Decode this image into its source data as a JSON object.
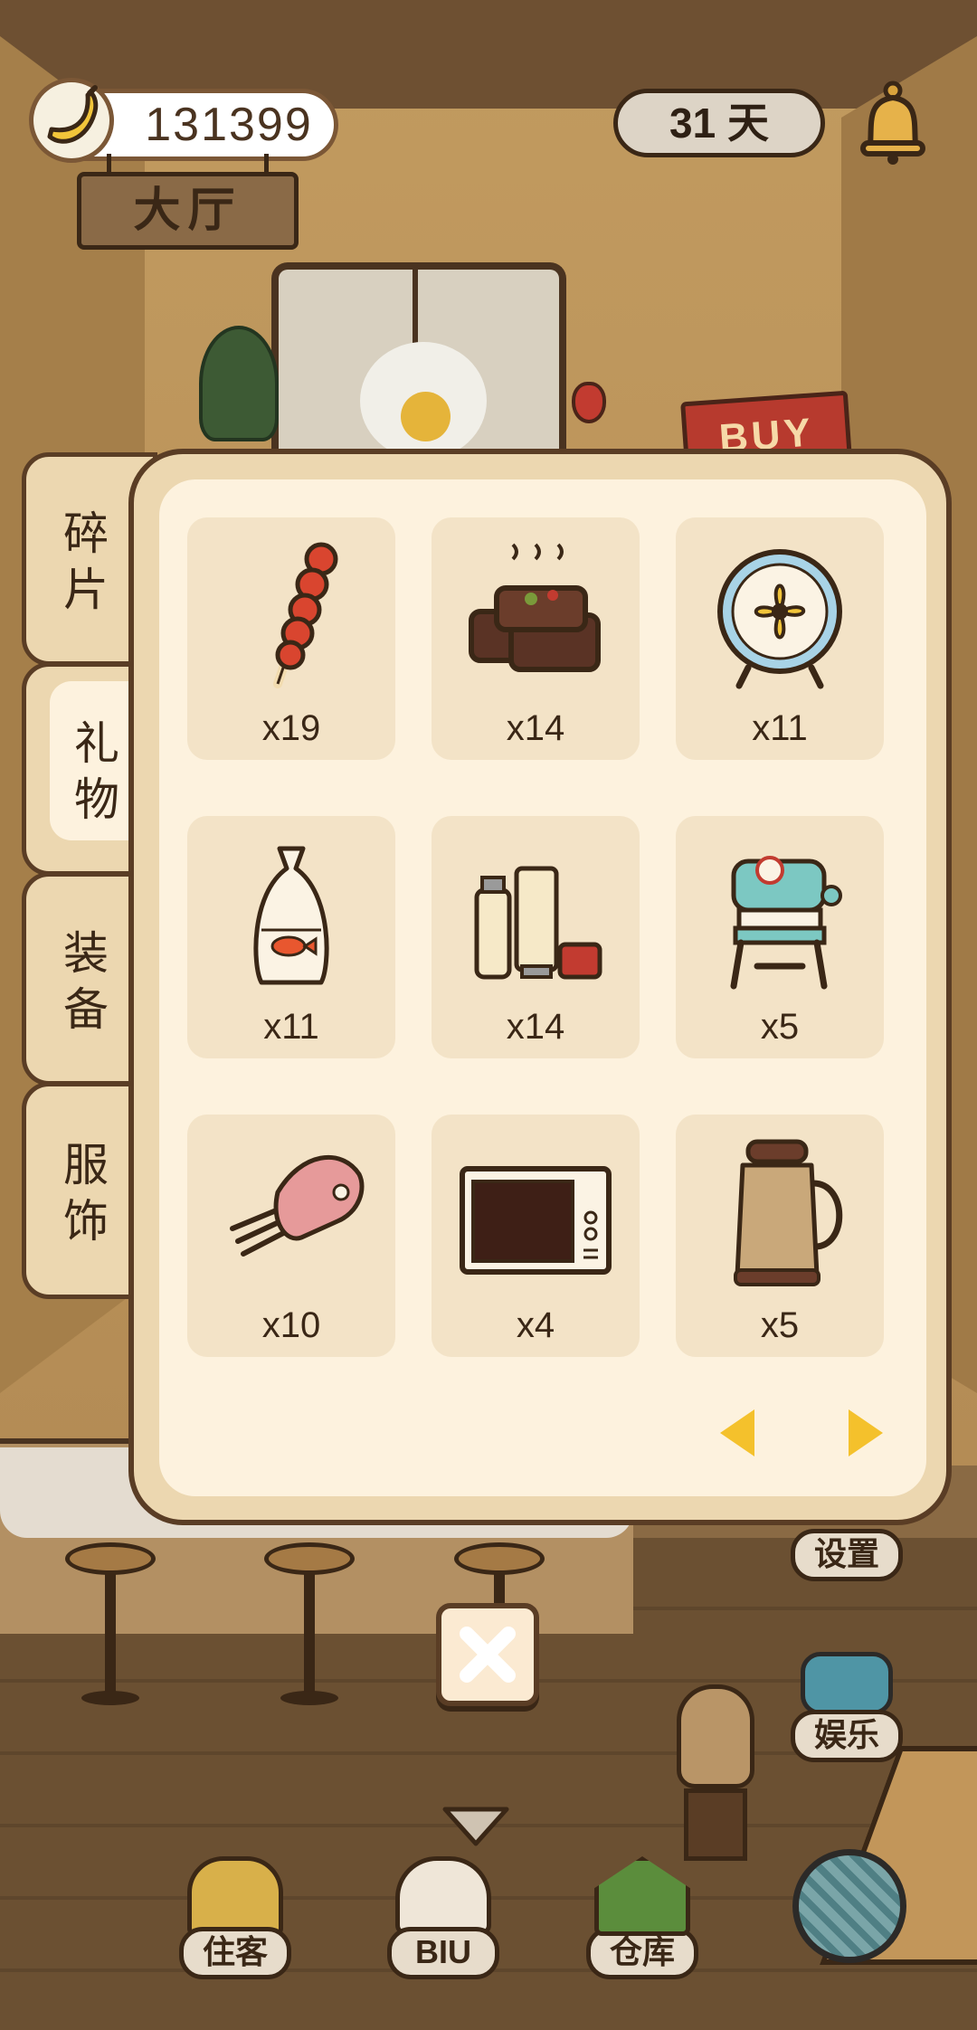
{
  "hud": {
    "bananas": "131399",
    "room_name": "大厅",
    "days": "31 天"
  },
  "scene": {
    "shop_sign": "BUY"
  },
  "panel": {
    "tabs": [
      {
        "label_l1": "碎",
        "label_l2": "片",
        "active": false
      },
      {
        "label_l1": "礼",
        "label_l2": "物",
        "active": true
      },
      {
        "label_l1": "装",
        "label_l2": "备",
        "active": false
      },
      {
        "label_l1": "服",
        "label_l2": "饰",
        "active": false
      }
    ],
    "items": [
      {
        "icon": "candied-haws-icon",
        "qty": "x19"
      },
      {
        "icon": "stinky-tofu-icon",
        "qty": "x14"
      },
      {
        "icon": "fan-icon",
        "qty": "x11"
      },
      {
        "icon": "goldfish-bag-icon",
        "qty": "x11"
      },
      {
        "icon": "skincare-bottles-icon",
        "qty": "x14"
      },
      {
        "icon": "shaved-ice-machine-icon",
        "qty": "x5"
      },
      {
        "icon": "hand-mixer-icon",
        "qty": "x10"
      },
      {
        "icon": "microwave-icon",
        "qty": "x4"
      },
      {
        "icon": "soymilk-maker-icon",
        "qty": "x5"
      }
    ]
  },
  "side_menu": {
    "settings": "设置",
    "entertainment": "娱乐"
  },
  "bottom_nav": {
    "guests": "住客",
    "biu": "BIU",
    "warehouse": "仓库"
  },
  "colors": {
    "panel_bg": "#ecd7b0",
    "panel_inner": "#fdf2de",
    "slot_bg": "#f3e3c7",
    "outline": "#5a3d25",
    "pager_arrow": "#f4c12c"
  }
}
